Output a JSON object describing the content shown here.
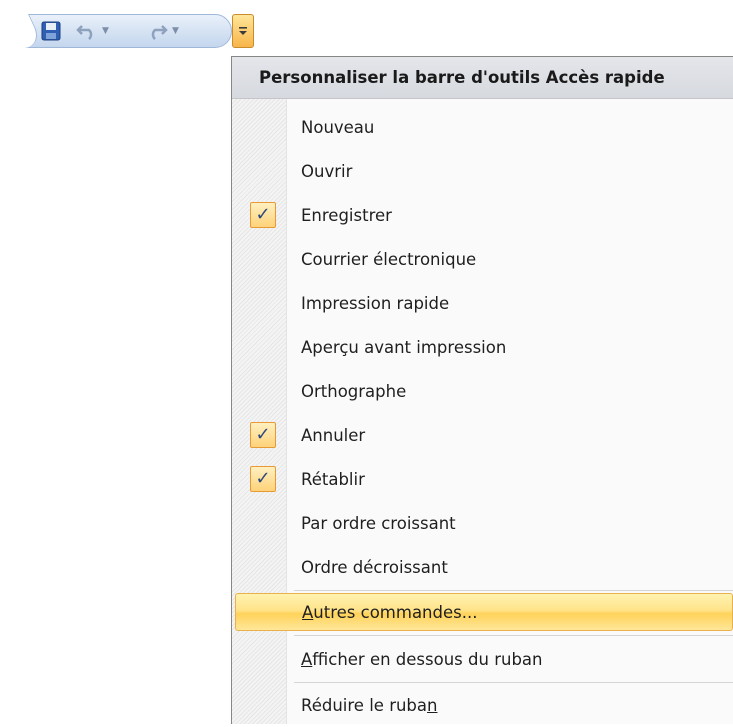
{
  "toolbar": {
    "buttons": [
      {
        "name": "save",
        "icon": "save-icon"
      },
      {
        "name": "undo",
        "icon": "undo-icon",
        "dropdown": "chevron-down-icon"
      },
      {
        "name": "redo",
        "icon": "redo-icon",
        "dropdown": "chevron-down-icon"
      },
      {
        "name": "customize",
        "icon": "customize-dropdown-icon"
      }
    ]
  },
  "menu": {
    "title": "Personnaliser la barre d'outils Accès rapide",
    "items": [
      {
        "label": "Nouveau",
        "checked": false
      },
      {
        "label": "Ouvrir",
        "checked": false
      },
      {
        "label": "Enregistrer",
        "checked": true
      },
      {
        "label": "Courrier électronique",
        "checked": false
      },
      {
        "label": "Impression rapide",
        "checked": false
      },
      {
        "label": "Aperçu avant impression",
        "checked": false
      },
      {
        "label": "Orthographe",
        "checked": false
      },
      {
        "label": "Annuler",
        "checked": true
      },
      {
        "label": "Rétablir",
        "checked": true
      },
      {
        "label": "Par ordre croissant",
        "checked": false
      },
      {
        "label": "Ordre décroissant",
        "checked": false
      }
    ],
    "more_commands": {
      "accel": "A",
      "rest": "utres commandes...",
      "highlighted": true
    },
    "show_below_ribbon": {
      "accel": "A",
      "rest": "fficher en dessous du ruban"
    },
    "minimize_ribbon": {
      "pre": "Réduire le ruba",
      "accel": "n"
    }
  },
  "colors": {
    "highlight": "#ffd35a",
    "check_border": "#e79b36",
    "toolbar_bg": "#d6e3f3"
  }
}
